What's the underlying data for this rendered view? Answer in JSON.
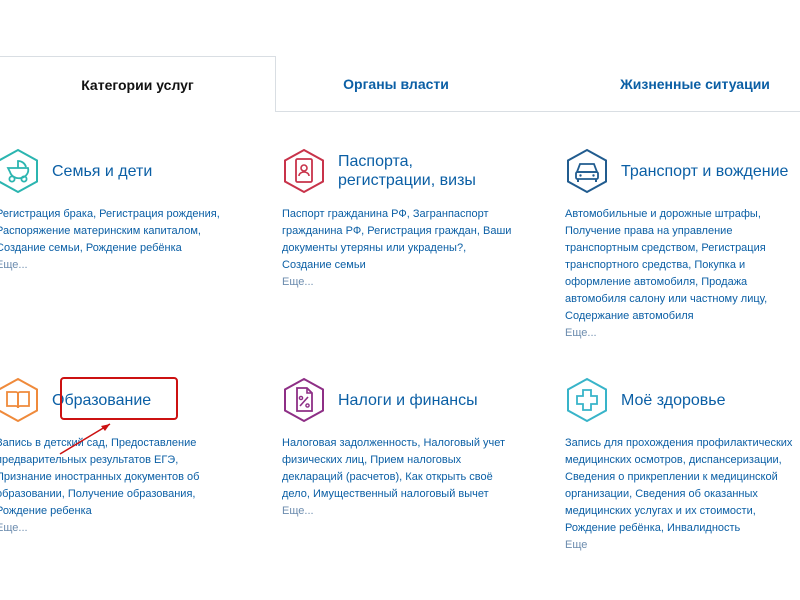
{
  "tabs": [
    {
      "label": "Категории услуг",
      "active": true
    },
    {
      "label": "Органы власти",
      "active": false
    },
    {
      "label": "Жизненные ситуации",
      "active": false
    }
  ],
  "categories": [
    {
      "title": "Семья и дети",
      "icon": "stroller-icon",
      "color": "#2bb5b0",
      "description": "Регистрация брака, Регистрация рождения, Распоряжение материнским капиталом, Создание семьи, Рождение ребёнка",
      "more": "Еще..."
    },
    {
      "title": "Паспорта, регистрации, визы",
      "title_lines": [
        "Паспорта,",
        "регистрации, визы"
      ],
      "icon": "passport-icon",
      "color": "#c8334a",
      "description": "Паспорт гражданина РФ, Загранпаспорт гражданина РФ, Регистрация граждан, Ваши документы утеряны или украдены?, Создание семьи",
      "more": "Еще..."
    },
    {
      "title": "Транспорт и вождение",
      "icon": "car-icon",
      "color": "#215c8f",
      "description": "Автомобильные и дорожные штрафы, Получение права на управление транспортным средством, Регистрация транспортного средства, Покупка и оформление автомобиля, Продажа автомобиля салону или частному лицу, Содержание автомобиля",
      "more": "Еще..."
    },
    {
      "title": "Образование",
      "icon": "book-icon",
      "color": "#ef8a3b",
      "description": "Запись в детский сад, Предоставление предварительных результатов ЕГЭ, Признание иностранных документов об образовании, Получение образования, Рождение ребенка",
      "more": "Еще..."
    },
    {
      "title": "Налоги и финансы",
      "icon": "tax-document-icon",
      "color": "#8e2f86",
      "description": "Налоговая задолженность, Налоговый учет физических лиц, Прием налоговых деклараций (расчетов), Как открыть своё дело, Имущественный налоговый вычет",
      "more": "Еще..."
    },
    {
      "title": "Моё здоровье",
      "icon": "medical-cross-icon",
      "color": "#38b4c9",
      "description": "Запись для прохождения профилактических медицинских осмотров, диспансеризации, Сведения о прикреплении к медицинской организации, Сведения об оказанных медицинских услугах и их стоимости, Рождение ребёнка, Инвалидность",
      "more": "Еще"
    }
  ],
  "colors": {
    "link": "#0b5fa5",
    "annotation": "#cc1111",
    "divider": "#d9dee3"
  }
}
